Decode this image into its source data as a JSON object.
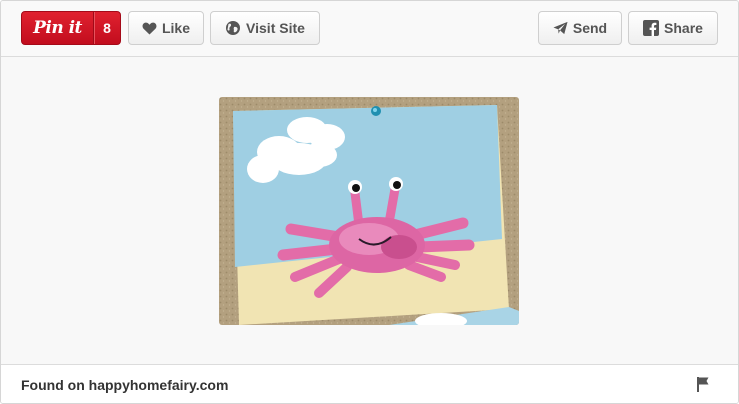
{
  "toolbar": {
    "pin": {
      "label": "Pin it",
      "count": "8"
    },
    "like_label": "Like",
    "visit_label": "Visit Site",
    "send_label": "Send",
    "share_label": "Share"
  },
  "footer": {
    "found_on": "Found on happyhomefairy.com"
  },
  "icons": {
    "like": "heart-icon",
    "visit": "globe-icon",
    "send": "paper-plane-icon",
    "share": "facebook-icon",
    "report": "flag-icon"
  },
  "colors": {
    "pin_red": "#cb2027",
    "paper_blue": "#9fd0e4",
    "sand": "#f2e4ae",
    "crab_pink": "#e06aa6"
  }
}
